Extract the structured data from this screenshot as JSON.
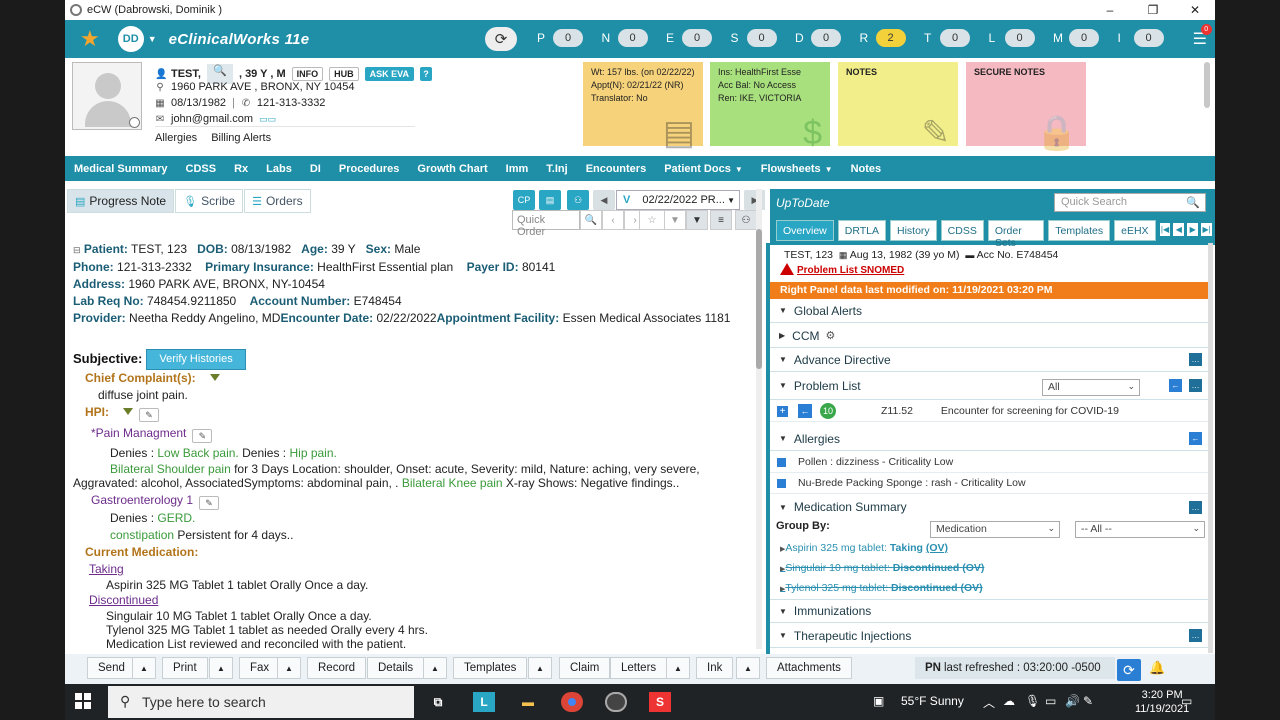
{
  "window": {
    "title": "eCW (Dabrowski, Dominik )",
    "min": "–",
    "max": "❐",
    "close": "✕"
  },
  "appbar": {
    "user_initials": "DD",
    "brand": "eClinicalWorks 11e",
    "counters": [
      {
        "letter": "P",
        "value": "0"
      },
      {
        "letter": "N",
        "value": "0"
      },
      {
        "letter": "E",
        "value": "0"
      },
      {
        "letter": "S",
        "value": "0"
      },
      {
        "letter": "D",
        "value": "0"
      },
      {
        "letter": "R",
        "value": "2"
      },
      {
        "letter": "T",
        "value": "0"
      },
      {
        "letter": "L",
        "value": "0"
      },
      {
        "letter": "M",
        "value": "0"
      },
      {
        "letter": "I",
        "value": "0"
      }
    ],
    "notif": "0"
  },
  "patient": {
    "name": "TEST,",
    "age": ", 39 Y , M",
    "info": "INFO",
    "hub": "HUB",
    "ask_eva": "ASK EVA",
    "help": "?",
    "address": "1960 PARK AVE , BRONX, NY 10454",
    "dob": "08/13/1982",
    "phone": "121-313-3332",
    "email": "john@gmail.com",
    "allergies": "Allergies",
    "billing_alerts": "Billing Alerts"
  },
  "cards": {
    "yellow": [
      "Wt: 157 lbs. (on 02/22/22)",
      "Appt(N): 02/21/22 (NR)",
      "Translator: No"
    ],
    "green": [
      "Ins: HealthFirst Esse",
      "Acc Bal: No Access",
      "Ren: IKE, VICTORIA"
    ],
    "notes": "NOTES",
    "secure": "SECURE NOTES"
  },
  "nav": [
    {
      "label": "Medical Summary"
    },
    {
      "label": "CDSS"
    },
    {
      "label": "Rx"
    },
    {
      "label": "Labs"
    },
    {
      "label": "DI"
    },
    {
      "label": "Procedures"
    },
    {
      "label": "Growth Chart"
    },
    {
      "label": "Imm"
    },
    {
      "label": "T.Inj"
    },
    {
      "label": "Encounters"
    },
    {
      "label": "Patient Docs",
      "dd": "▼"
    },
    {
      "label": "Flowsheets",
      "dd": "▼"
    },
    {
      "label": "Notes"
    }
  ],
  "main": {
    "tabs": [
      "Progress Note",
      "Scribe",
      "Orders"
    ],
    "cp": "CP",
    "date": "02/22/2022 PR...",
    "quick_order": "Quick Order",
    "v": "V"
  },
  "doc": {
    "patient_l": "Patient:",
    "patient_v": "TEST, 123",
    "dob_l": "DOB:",
    "dob_v": "08/13/1982",
    "age_l": "Age:",
    "age_v": "39 Y",
    "sex_l": "Sex:",
    "sex_v": "Male",
    "phone_l": "Phone:",
    "phone_v": "121-313-2332",
    "ins_l": "Primary Insurance:",
    "ins_v": "HealthFirst Essential plan",
    "payer_l": "Payer ID:",
    "payer_v": "80141",
    "addr_l": "Address:",
    "addr_v": "1960 PARK AVE, BRONX, NY-10454",
    "lab_l": "Lab Req No:",
    "lab_v": "748454.9211850",
    "acct_l": "Account Number:",
    "acct_v": "E748454",
    "prov_l": "Provider:",
    "prov_v": "Neetha Reddy Angelino, MD",
    "enc_l": "Encounter Date:",
    "enc_v": "02/22/2022",
    "appt_l": "Appointment Facility:",
    "appt_v": "Essen Medical Associates 1181",
    "subjective": "Subjective:",
    "verify": "Verify Histories",
    "cc": "Chief Complaint(s):",
    "cc_v": "diffuse joint pain.",
    "hpi": "HPI:",
    "pain_title": "*Pain Managment",
    "denies": "Denies :",
    "lbp": "Low Back pain.",
    "denies2": "Denies :",
    "hip": "Hip pain.",
    "bsp": "Bilateral Shoulder pain",
    "bsp_rest": " for 3 Days  Location: shoulder, Onset: acute, Severity: mild, Nature: aching, very severe, Aggravated: alcohol, AssociatedSymptoms: abdominal pain, . ",
    "bkp": "Bilateral Knee pain",
    "bkp_rest": "  X-ray Shows: Negative findings..",
    "gastro": "Gastroenterology 1",
    "denies3": "Denies :",
    "gerd": "GERD.",
    "const": "constipation",
    "const_rest": "  Persistent for 4 days..",
    "curmed": "Current Medication:",
    "taking": "Taking",
    "taking1": "Aspirin 325 MG Tablet 1 tablet Orally Once a day.",
    "disc": "Discontinued",
    "disc1": "Singulair 10 MG Tablet 1 tablet Orally Once a day.",
    "disc2": "Tylenol 325 MG Tablet 1 tablet as needed Orally every 4 hrs.",
    "reviewed": "Medication List reviewed and reconciled with the patient."
  },
  "right": {
    "title": "UpToDate",
    "search_ph": "Quick Search",
    "tabs": [
      "Overview",
      "DRTLA",
      "History",
      "CDSS",
      "Order Sets",
      "Templates",
      "eEHX"
    ],
    "pt": "TEST, 123",
    "pt_dob": "Aug 13, 1982 (39 yo M)",
    "acc": "Acc No. E748454",
    "snomed": "Problem List SNOMED",
    "modified": "Right Panel data last modified on: 11/19/2021 03:20 PM",
    "global_alerts": "Global Alerts",
    "ccm": "CCM",
    "advance": "Advance Directive",
    "problem_list": "Problem List",
    "pl_filter": "All",
    "pl_badge": "10",
    "pl_code": "Z11.52",
    "pl_desc": "Encounter for screening for COVID-19",
    "allergies": "Allergies",
    "allergy1": "Pollen : dizziness - Criticality Low",
    "allergy2": "Nu-Brede Packing Sponge : rash - Criticality Low",
    "med_summary": "Medication Summary",
    "group_by": "Group By:",
    "group_sel": "Medication",
    "group_all": "-- All --",
    "med1": "Aspirin 325 mg tablet:",
    "med1_s": "Taking",
    "med1_ov": "(OV)",
    "med2": "Singulair 10 mg tablet:",
    "med2_s": "Discontinued",
    "med2_ov": "(OV)",
    "med3": "Tylenol 325 mg tablet:",
    "med3_s": "Discontinued",
    "med3_ov": "(OV)",
    "immunizations": "Immunizations",
    "ther_inj": "Therapeutic Injections"
  },
  "bottom": {
    "send": "Send",
    "print": "Print",
    "fax": "Fax",
    "record": "Record",
    "details": "Details",
    "templates": "Templates",
    "claim": "Claim",
    "letters": "Letters",
    "ink": "Ink",
    "attachments": "Attachments",
    "pn_l": "PN",
    "pn_v": "last refreshed : 03:20:00 -0500"
  },
  "taskbar": {
    "search": "Type here to search",
    "weather": "55°F  Sunny",
    "time": "3:20 PM",
    "date": "11/19/2021"
  }
}
